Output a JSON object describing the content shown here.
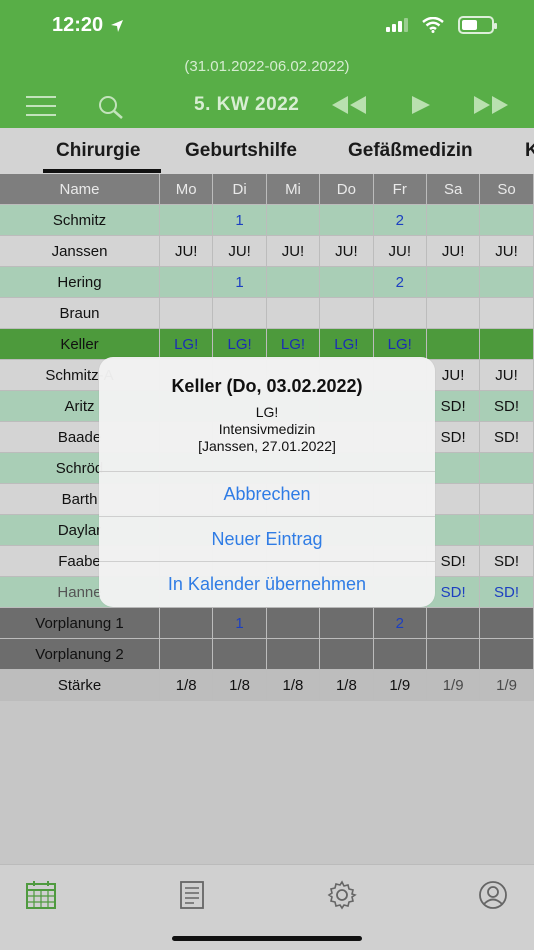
{
  "status": {
    "time": "12:20"
  },
  "header": {
    "date_range": "(31.01.2022-06.02.2022)",
    "week_label": "5. KW 2022"
  },
  "tabs": [
    {
      "label": "Chirurgie"
    },
    {
      "label": "Geburtshilfe"
    },
    {
      "label": "Gefäßmedizin"
    },
    {
      "label": "K"
    }
  ],
  "table": {
    "headers": [
      "Name",
      "Mo",
      "Di",
      "Mi",
      "Do",
      "Fr",
      "Sa",
      "So"
    ],
    "rows": [
      {
        "name": "Schmitz",
        "cells": [
          "",
          "1",
          "",
          "",
          "2",
          "",
          ""
        ]
      },
      {
        "name": "Janssen",
        "cells": [
          "JU!",
          "JU!",
          "JU!",
          "JU!",
          "JU!",
          "JU!",
          "JU!"
        ]
      },
      {
        "name": "Hering",
        "cells": [
          "",
          "1",
          "",
          "",
          "2",
          "",
          ""
        ]
      },
      {
        "name": "Braun",
        "cells": [
          "",
          "",
          "",
          "",
          "",
          "",
          ""
        ]
      },
      {
        "name": "Keller",
        "cells": [
          "LG!",
          "LG!",
          "LG!",
          "LG!",
          "LG!",
          "",
          ""
        ]
      },
      {
        "name": "Schmitz-A",
        "cells": [
          "",
          "",
          "",
          "",
          "",
          "JU!",
          "JU!"
        ]
      },
      {
        "name": "Aritz",
        "cells": [
          "",
          "",
          "",
          "",
          "",
          "SD!",
          "SD!"
        ]
      },
      {
        "name": "Baade",
        "cells": [
          "",
          "",
          "",
          "",
          "",
          "SD!",
          "SD!"
        ]
      },
      {
        "name": "Schröd",
        "cells": [
          "",
          "",
          "",
          "",
          "",
          "",
          ""
        ]
      },
      {
        "name": "Barth",
        "cells": [
          "",
          "",
          "",
          "",
          "",
          "",
          ""
        ]
      },
      {
        "name": "Daylar",
        "cells": [
          "",
          "",
          "",
          "",
          "",
          "",
          ""
        ]
      },
      {
        "name": "Faabe",
        "cells": [
          "",
          "",
          "",
          "",
          "",
          "SD!",
          "SD!"
        ]
      },
      {
        "name": "Hanne",
        "cells": [
          "",
          "",
          "",
          "",
          "",
          "SD!",
          "SD!"
        ]
      },
      {
        "name": "Vorplanung 1",
        "cells": [
          "",
          "1",
          "",
          "",
          "2",
          "",
          ""
        ]
      },
      {
        "name": "Vorplanung 2",
        "cells": [
          "",
          "",
          "",
          "",
          "",
          "",
          ""
        ]
      }
    ],
    "sum": {
      "name": "Stärke",
      "cells": [
        "1/8",
        "1/8",
        "1/8",
        "1/8",
        "1/9",
        "1/9",
        "1/9"
      ]
    }
  },
  "alert": {
    "title": "Keller (Do, 03.02.2022)",
    "line1": "LG!",
    "line2": "Intensivmedizin",
    "line3": "[Janssen, 27.01.2022]",
    "cancel": "Abbrechen",
    "new_entry": "Neuer Eintrag",
    "calendar": "In Kalender übernehmen"
  },
  "icons": {
    "location": "location-arrow-icon",
    "menu": "menu-icon",
    "search": "search-icon",
    "rewind": "rewind-icon",
    "play": "play-icon",
    "fast_forward": "fast-forward-icon"
  }
}
